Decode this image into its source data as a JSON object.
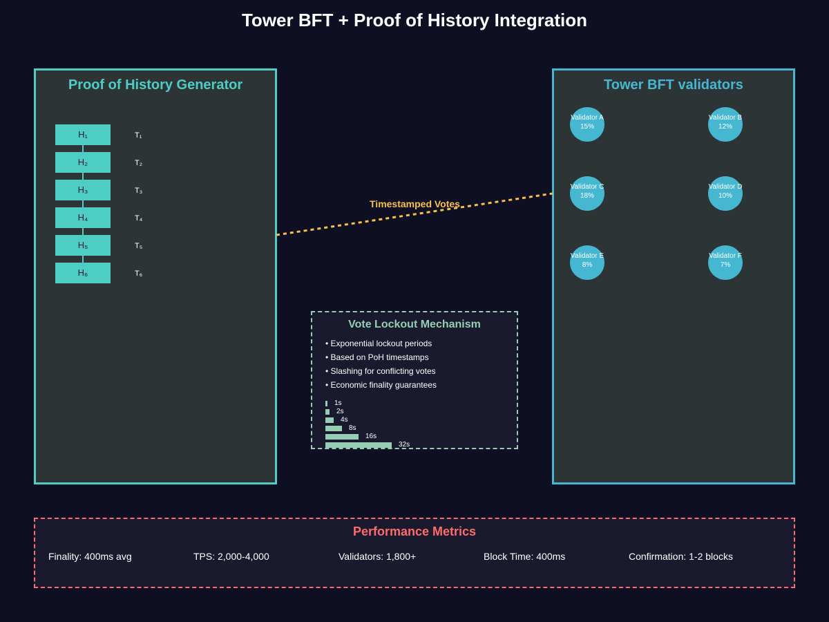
{
  "title": "Tower BFT + Proof of History Integration",
  "poh": {
    "title": "Proof of History Generator",
    "hashes": [
      "H₁",
      "H₂",
      "H₃",
      "H₄",
      "H₅",
      "H₆"
    ],
    "timestamps": [
      "T₁",
      "T₂",
      "T₃",
      "T₄",
      "T₅",
      "T₆"
    ]
  },
  "tower": {
    "title": "Tower BFT validators",
    "validators": [
      {
        "name": "Validator A",
        "stake": "15%"
      },
      {
        "name": "Validator B",
        "stake": "12%"
      },
      {
        "name": "Validator C",
        "stake": "18%"
      },
      {
        "name": "Validator D",
        "stake": "10%"
      },
      {
        "name": "Validator E",
        "stake": "8%"
      },
      {
        "name": "Validator F",
        "stake": "7%"
      }
    ]
  },
  "connection": {
    "label": "Timestamped Votes"
  },
  "lockout": {
    "title": "Vote Lockout Mechanism",
    "bullets": [
      "• Exponential lockout periods",
      "• Based on PoH timestamps",
      "• Slashing for conflicting votes",
      "• Economic finality guarantees"
    ],
    "periods": [
      {
        "label": "1s",
        "seconds": 1
      },
      {
        "label": "2s",
        "seconds": 2
      },
      {
        "label": "4s",
        "seconds": 4
      },
      {
        "label": "8s",
        "seconds": 8
      },
      {
        "label": "16s",
        "seconds": 16
      },
      {
        "label": "32s",
        "seconds": 32
      }
    ]
  },
  "metrics": {
    "title": "Performance Metrics",
    "items": [
      "Finality: 400ms avg",
      "TPS: 2,000-4,000",
      "Validators: 1,800+",
      "Block Time: 400ms",
      "Confirmation: 1-2 blocks"
    ]
  },
  "colors": {
    "background": "#0e0f22",
    "poh_accent": "#4ecdc4",
    "tower_accent": "#45b7d1",
    "votes": "#f7c04a",
    "lockout": "#96ceb4",
    "metrics": "#ff6b6b"
  }
}
